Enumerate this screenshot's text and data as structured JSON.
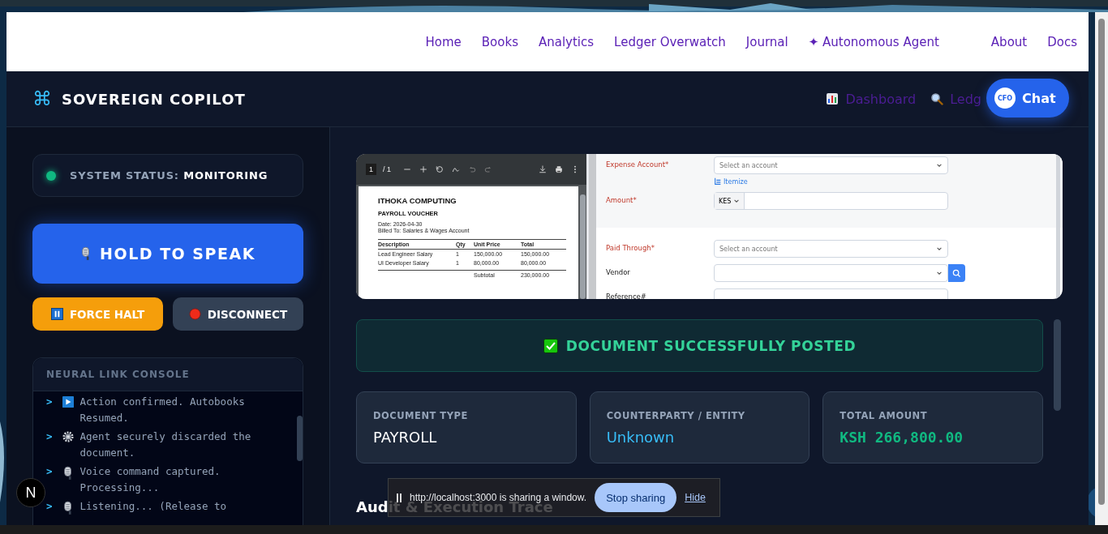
{
  "nav": {
    "links": [
      {
        "label": "Home"
      },
      {
        "label": "Books"
      },
      {
        "label": "Analytics"
      },
      {
        "label": "Ledger Overwatch"
      },
      {
        "label": "Journal"
      },
      {
        "label": "✦ Autonomous Agent"
      },
      {
        "label": "About"
      },
      {
        "label": "Docs"
      }
    ]
  },
  "app": {
    "glyph": "⌘",
    "title": "SOVEREIGN COPILOT",
    "header_links": [
      {
        "kind": "chart",
        "label": "Dashboard"
      },
      {
        "kind": "search",
        "label": "Ledg"
      }
    ]
  },
  "chat_button": {
    "badge": "CFO",
    "label": "Chat"
  },
  "status": {
    "label": "SYSTEM STATUS:",
    "value": "MONITORING"
  },
  "controls": {
    "speak": "HOLD TO SPEAK",
    "halt": "FORCE HALT",
    "disconnect": "DISCONNECT"
  },
  "console": {
    "title": "NEURAL LINK CONSOLE",
    "prompt": ">",
    "lines": [
      {
        "kind": "play",
        "text": "Action confirmed. Autobooks Resumed."
      },
      {
        "kind": "gear",
        "text": "Agent securely discarded the document."
      },
      {
        "kind": "mic",
        "text": "Voice command captured. Processing..."
      },
      {
        "kind": "mic",
        "text": "Listening... (Release to"
      }
    ]
  },
  "preview": {
    "pdf": {
      "page": "1",
      "pages": "/ 1",
      "company": "ITHOKA COMPUTING",
      "title": "PAYROLL VOUCHER",
      "date": "Date: 2026-04-30",
      "billed": "Billed To: Salaries & Wages Account",
      "columns": [
        "Description",
        "Qty",
        "Unit Price",
        "Total"
      ],
      "rows": [
        [
          "Lead Engineer Salary",
          "1",
          "150,000.00",
          "150,000.00"
        ],
        [
          "UI Developer Salary",
          "1",
          "80,000.00",
          "80,000.00"
        ]
      ],
      "subtotal": [
        "Subtotal",
        "230,000.00"
      ]
    },
    "form": {
      "fields": [
        {
          "kind": "select",
          "label": "Expense Account*",
          "required": true,
          "placeholder": "Select an account",
          "link": "Itemize"
        },
        {
          "kind": "currency",
          "label": "Amount*",
          "required": true,
          "currency": "KES"
        },
        {
          "kind": "select",
          "label": "Paid Through*",
          "required": true,
          "placeholder": "Select an account"
        },
        {
          "kind": "search-select",
          "label": "Vendor",
          "required": false
        },
        {
          "kind": "text",
          "label": "Reference#",
          "required": false
        }
      ]
    }
  },
  "banner": {
    "text": "DOCUMENT SUCCESSFULLY POSTED"
  },
  "cards": [
    {
      "kind": "plain",
      "label": "DOCUMENT TYPE",
      "value": "PAYROLL"
    },
    {
      "kind": "link",
      "label": "COUNTERPARTY / ENTITY",
      "value": "Unknown"
    },
    {
      "kind": "money",
      "label": "TOTAL AMOUNT",
      "value": "KSH 266,800.00"
    }
  ],
  "section_heading": "Audit & Execution Trace",
  "sharing_bar": {
    "message": "http://localhost:3000 is sharing a window.",
    "stop": "Stop sharing",
    "hide": "Hide"
  },
  "dev_badge": {
    "letter": "N"
  }
}
